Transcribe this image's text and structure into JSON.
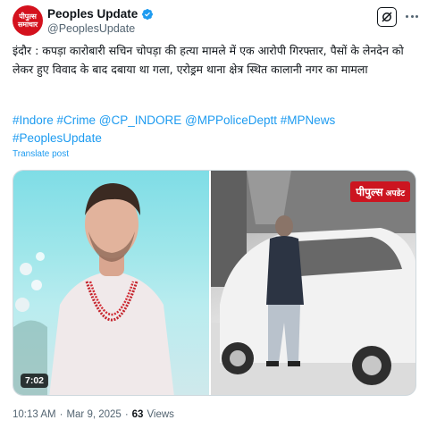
{
  "author": {
    "display_name": "Peoples Update",
    "handle": "@PeoplesUpdate",
    "avatar_text_line1": "पीपुल्स",
    "avatar_text_line2": "समाचार",
    "verified": true,
    "avatar_color": "#d4111d"
  },
  "post": {
    "text": "इंदौर : कपड़ा कारोबारी सचिन चोपड़ा की हत्या मामले में एक आरोपी गिरफ्तार, पैसों के लेनदेन को लेकर हुए विवाद के बाद दबाया था गला, एरोड्रम थाना क्षेत्र स्थित कालानी नगर का मामला",
    "hashtags": "#Indore #Crime @CP_INDORE @MPPoliceDeptt #MPNews #PeoplesUpdate",
    "translate_label": "Translate post"
  },
  "media": {
    "video_duration": "7:02",
    "brand_badge_main": "पीपुल्स",
    "brand_badge_sub": "अपडेट",
    "brand_color": "#cc1520"
  },
  "footer": {
    "time": "10:13 AM",
    "separator": "·",
    "date": "Mar 9, 2025",
    "views_count": "63",
    "views_label": "Views"
  },
  "icons": {
    "verified": "verified-badge-icon",
    "grok": "grok-icon",
    "more": "more-options-icon"
  },
  "colors": {
    "link": "#1d9bf0",
    "verified": "#1d9bf0",
    "secondary_text": "#536471"
  }
}
